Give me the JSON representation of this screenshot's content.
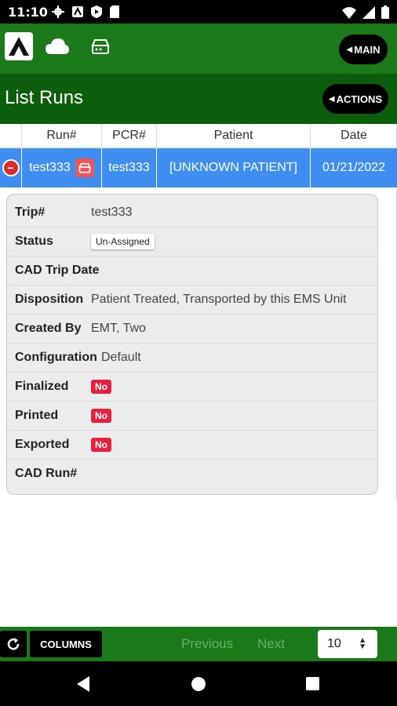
{
  "status_bar": {
    "time": "11:10"
  },
  "app_bar": {
    "main_label": "MAIN"
  },
  "title_bar": {
    "title": "List Runs",
    "actions_label": "ACTIONS"
  },
  "table": {
    "headers": [
      "Run#",
      "PCR#",
      "Patient",
      "Date"
    ],
    "rows": [
      {
        "run": "test333",
        "pcr": "test333",
        "patient": "[UNKNOWN PATIENT]",
        "date": "01/21/2022"
      }
    ]
  },
  "details": {
    "rows": [
      {
        "label": "Trip#",
        "value": "test333"
      },
      {
        "label": "Status",
        "value": "Un-Assigned"
      },
      {
        "label": "CAD Trip Date",
        "value": ""
      },
      {
        "label": "Disposition",
        "value": "Patient Treated, Transported by this EMS Unit"
      },
      {
        "label": "Created By",
        "value": "EMT, Two"
      },
      {
        "label": "Configuration",
        "value": "Default"
      },
      {
        "label": "Finalized",
        "value": "No"
      },
      {
        "label": "Printed",
        "value": "No"
      },
      {
        "label": "Exported",
        "value": "No"
      },
      {
        "label": "CAD Run#",
        "value": ""
      }
    ]
  },
  "bottom_bar": {
    "columns_label": "COLUMNS",
    "previous_label": "Previous",
    "next_label": "Next",
    "page_size": "10"
  },
  "colors": {
    "app_bar": "#1a7a18",
    "title_bar": "#0b5e0b",
    "selected_row": "#3d8ef0",
    "no_badge": "#e8203f"
  }
}
